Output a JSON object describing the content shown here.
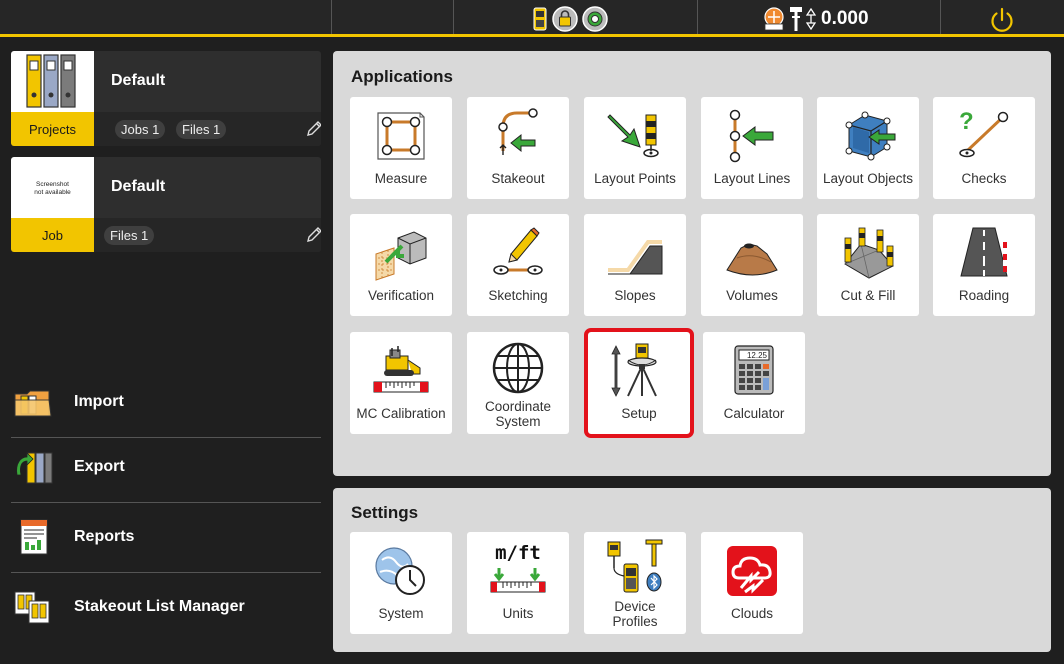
{
  "topbar": {
    "height_value": "0.000"
  },
  "projects_card": {
    "title": "Default",
    "thumb_label": "Projects",
    "jobs_chip": "Jobs 1",
    "files_chip": "Files 1"
  },
  "job_card": {
    "title": "Default",
    "thumb_label": "Job",
    "files_chip": "Files 1",
    "no_screenshot_line1": "Screenshot",
    "no_screenshot_line2": "not available"
  },
  "menu": [
    {
      "label": "Import",
      "icon": "import-icon"
    },
    {
      "label": "Export",
      "icon": "export-icon"
    },
    {
      "label": "Reports",
      "icon": "reports-icon"
    },
    {
      "label": "Stakeout List Manager",
      "icon": "stakeout-list-icon"
    }
  ],
  "applications": {
    "title": "Applications",
    "tiles": [
      {
        "label": "Measure",
        "icon": "measure-icon"
      },
      {
        "label": "Stakeout",
        "icon": "stakeout-icon"
      },
      {
        "label": "Layout Points",
        "icon": "layout-points-icon"
      },
      {
        "label": "Layout Lines",
        "icon": "layout-lines-icon"
      },
      {
        "label": "Layout Objects",
        "icon": "layout-objects-icon"
      },
      {
        "label": "Checks",
        "icon": "checks-icon"
      },
      {
        "label": "Verification",
        "icon": "verification-icon"
      },
      {
        "label": "Sketching",
        "icon": "sketching-icon"
      },
      {
        "label": "Slopes",
        "icon": "slopes-icon"
      },
      {
        "label": "Volumes",
        "icon": "volumes-icon"
      },
      {
        "label": "Cut & Fill",
        "icon": "cut-fill-icon"
      },
      {
        "label": "Roading",
        "icon": "roading-icon"
      },
      {
        "label": "MC Calibration",
        "icon": "mc-calibration-icon"
      },
      {
        "label_line1": "Coordinate",
        "label_line2": "System",
        "icon": "globe-icon"
      },
      {
        "label": "Setup",
        "icon": "setup-icon",
        "selected": true
      },
      {
        "label": "Calculator",
        "icon": "calculator-icon",
        "display": "12.25"
      }
    ]
  },
  "settings": {
    "title": "Settings",
    "tiles": [
      {
        "label": "System",
        "icon": "system-icon"
      },
      {
        "label": "Units",
        "icon": "units-icon",
        "badge": "m/ft"
      },
      {
        "label_line1": "Device",
        "label_line2": "Profiles",
        "icon": "device-profiles-icon"
      },
      {
        "label": "Clouds",
        "icon": "clouds-icon"
      }
    ]
  },
  "colors": {
    "accent": "#f2c500",
    "selection": "#e3121b",
    "panel": "#d9d9d9",
    "background": "#1f1f1f",
    "green_arrow": "#3aa83a"
  }
}
